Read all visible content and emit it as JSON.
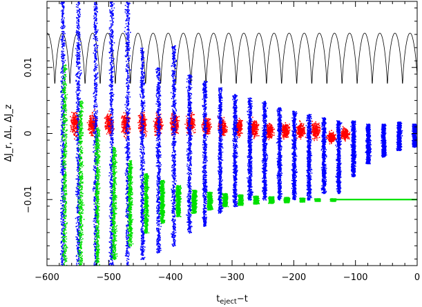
{
  "chart_data": {
    "type": "scatter",
    "xlabel_main": "t",
    "xlabel_sub": "eject",
    "xlabel_suffix": "−t",
    "ylabel": "ΔJ_r, ΔL, ΔJ_z",
    "xlim": [
      -600,
      0
    ],
    "ylim": [
      -0.02,
      0.02
    ],
    "x_ticks": [
      -600,
      -500,
      -400,
      -300,
      -200,
      -100,
      0
    ],
    "x_tick_labels": [
      "−600",
      "−500",
      "−400",
      "−300",
      "−200",
      "−100",
      "0"
    ],
    "y_ticks": [
      -0.01,
      0,
      0.01
    ],
    "y_tick_labels": [
      "−0.01",
      "0",
      "0.01"
    ],
    "grid": false,
    "colors": {
      "Jr": "#ff0000",
      "L": "#0000ff",
      "Jz": "#00e000",
      "orbit": "#000000"
    },
    "series": [
      {
        "key": "Jr",
        "color": "#ff0000",
        "marker": "dot",
        "stripes": [
          {
            "x": -555,
            "center": 0.0015,
            "spread": 0.003
          },
          {
            "x": -527,
            "center": 0.0015,
            "spread": 0.003
          },
          {
            "x": -500,
            "center": 0.0015,
            "spread": 0.003
          },
          {
            "x": -473,
            "center": 0.0015,
            "spread": 0.003
          },
          {
            "x": -446,
            "center": 0.0015,
            "spread": 0.0028
          },
          {
            "x": -420,
            "center": 0.0015,
            "spread": 0.0028
          },
          {
            "x": -394,
            "center": 0.0015,
            "spread": 0.0028
          },
          {
            "x": -368,
            "center": 0.0015,
            "spread": 0.0026
          },
          {
            "x": -342,
            "center": 0.0012,
            "spread": 0.0025
          },
          {
            "x": -316,
            "center": 0.001,
            "spread": 0.0024
          },
          {
            "x": -290,
            "center": 0.001,
            "spread": 0.0022
          },
          {
            "x": -265,
            "center": 0.0008,
            "spread": 0.0022
          },
          {
            "x": -240,
            "center": 0.0005,
            "spread": 0.002
          },
          {
            "x": -215,
            "center": 0.0005,
            "spread": 0.002
          },
          {
            "x": -190,
            "center": 0.0005,
            "spread": 0.002
          },
          {
            "x": -165,
            "center": 0.0005,
            "spread": 0.002
          },
          {
            "x": -140,
            "center": -0.0005,
            "spread": 0.0015
          },
          {
            "x": -118,
            "center": 0.0,
            "spread": 0.0015
          }
        ]
      },
      {
        "key": "L",
        "color": "#0000ff",
        "marker": "dot",
        "stripes": [
          {
            "x": -575,
            "ymin": -0.02,
            "ymax": 0.02
          },
          {
            "x": -550,
            "ymin": -0.02,
            "ymax": 0.02
          },
          {
            "x": -522,
            "ymin": -0.02,
            "ymax": 0.02
          },
          {
            "x": -496,
            "ymin": -0.02,
            "ymax": 0.02
          },
          {
            "x": -470,
            "ymin": -0.02,
            "ymax": 0.02
          },
          {
            "x": -446,
            "ymin": -0.019,
            "ymax": 0.013
          },
          {
            "x": -420,
            "ymin": -0.018,
            "ymax": 0.01
          },
          {
            "x": -395,
            "ymin": -0.017,
            "ymax": 0.0135
          },
          {
            "x": -370,
            "ymin": -0.015,
            "ymax": 0.009
          },
          {
            "x": -345,
            "ymin": -0.014,
            "ymax": 0.008
          },
          {
            "x": -320,
            "ymin": -0.012,
            "ymax": 0.007
          },
          {
            "x": -296,
            "ymin": -0.011,
            "ymax": 0.006
          },
          {
            "x": -272,
            "ymin": -0.01,
            "ymax": 0.0055
          },
          {
            "x": -248,
            "ymin": -0.01,
            "ymax": 0.005
          },
          {
            "x": -224,
            "ymin": -0.01,
            "ymax": 0.004
          },
          {
            "x": -200,
            "ymin": -0.01,
            "ymax": 0.0035
          },
          {
            "x": -176,
            "ymin": -0.01,
            "ymax": 0.003
          },
          {
            "x": -152,
            "ymin": -0.009,
            "ymax": 0.0025
          },
          {
            "x": -128,
            "ymin": -0.009,
            "ymax": 0.002
          },
          {
            "x": -104,
            "ymin": -0.0065,
            "ymax": 0.002
          },
          {
            "x": -80,
            "ymin": -0.0045,
            "ymax": 0.0015
          },
          {
            "x": -55,
            "ymin": -0.0035,
            "ymax": 0.0015
          },
          {
            "x": -30,
            "ymin": -0.0025,
            "ymax": 0.0018
          },
          {
            "x": -5,
            "ymin": -0.002,
            "ymax": 0.0015
          }
        ]
      },
      {
        "key": "Jz",
        "color": "#00e000",
        "marker": "dot",
        "stripes": [
          {
            "x": -572,
            "ymin": -0.02,
            "ymax": 0.0105
          },
          {
            "x": -546,
            "ymin": -0.02,
            "ymax": 0.005
          },
          {
            "x": -519,
            "ymin": -0.02,
            "ymax": 0.001
          },
          {
            "x": -492,
            "ymin": -0.019,
            "ymax": -0.002
          },
          {
            "x": -466,
            "ymin": -0.017,
            "ymax": -0.004
          },
          {
            "x": -440,
            "ymin": -0.015,
            "ymax": -0.006
          },
          {
            "x": -414,
            "ymin": -0.0135,
            "ymax": -0.007
          },
          {
            "x": -388,
            "ymin": -0.0125,
            "ymax": -0.0078
          },
          {
            "x": -362,
            "ymin": -0.012,
            "ymax": -0.0085
          },
          {
            "x": -337,
            "ymin": -0.0115,
            "ymax": -0.0088
          },
          {
            "x": -312,
            "ymin": -0.011,
            "ymax": -0.009
          },
          {
            "x": -287,
            "ymin": -0.0108,
            "ymax": -0.0092
          },
          {
            "x": -262,
            "ymin": -0.0106,
            "ymax": -0.0094
          },
          {
            "x": -237,
            "ymin": -0.0105,
            "ymax": -0.0095
          },
          {
            "x": -212,
            "ymin": -0.0104,
            "ymax": -0.0096
          },
          {
            "x": -187,
            "ymin": -0.0103,
            "ymax": -0.0097
          },
          {
            "x": -162,
            "ymin": -0.0102,
            "ymax": -0.0098
          },
          {
            "x": -137,
            "ymin": -0.0102,
            "ymax": -0.0098
          }
        ],
        "line": {
          "x_from": -140,
          "x_to": 0,
          "y": -0.01
        }
      },
      {
        "key": "orbit",
        "color": "#000000",
        "marker": "line",
        "periodic": {
          "x_start": -600,
          "x_end": 0,
          "period": 24.5,
          "phase": -575,
          "ymax": 0.0152,
          "ymin": 0.0065
        }
      }
    ]
  }
}
